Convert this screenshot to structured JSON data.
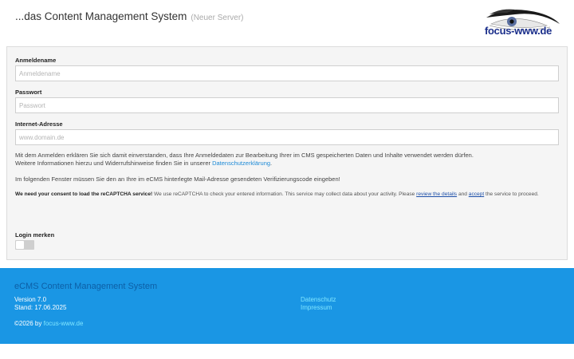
{
  "header": {
    "title": "...das Content Management System",
    "subtitle": "(Neuer Server)",
    "logo_text": "focus-www.de"
  },
  "form": {
    "username": {
      "label": "Anmeldename",
      "placeholder": "Anmeldename"
    },
    "password": {
      "label": "Passwort",
      "placeholder": "Passwort"
    },
    "address": {
      "label": "Internet-Adresse",
      "placeholder": "www.domain.de"
    },
    "note1": "Mit dem Anmelden erklären Sie sich damit einverstanden, dass Ihre Anmeldedaten zur Bearbeitung Ihrer im CMS gespeicherten Daten und Inhalte verwendet werden dürfen.",
    "note2_prefix": "Weitere Informationen hierzu und Widerrufshinweise finden Sie in unserer ",
    "note2_link": "Datenschutzerklärung",
    "note2_suffix": ".",
    "note3": "Im folgenden Fenster müssen Sie den an Ihre im eCMS hinterlegte Mail-Adresse gesendeten Verifizierungscode eingeben!",
    "consent_bold": "We need your consent to load the reCAPTCHA service!",
    "consent_text": " We use reCAPTCHA to check your entered information. This service may collect data about your activity. Please ",
    "consent_link1": "review the details",
    "consent_and": " and ",
    "consent_link2": "accept",
    "consent_end": " the service to proceed.",
    "remember_label": "Login merken"
  },
  "footer": {
    "title": "eCMS Content Management System",
    "version": "Version 7.0",
    "date": "Stand: 17.06.2025",
    "link_privacy": "Datenschutz",
    "link_imprint": "Impressum",
    "copy_prefix": "©2026 by ",
    "copy_link": "focus-www.de"
  },
  "colors": {
    "footer_bg": "#1a96e4",
    "link": "#1d8ad6"
  }
}
